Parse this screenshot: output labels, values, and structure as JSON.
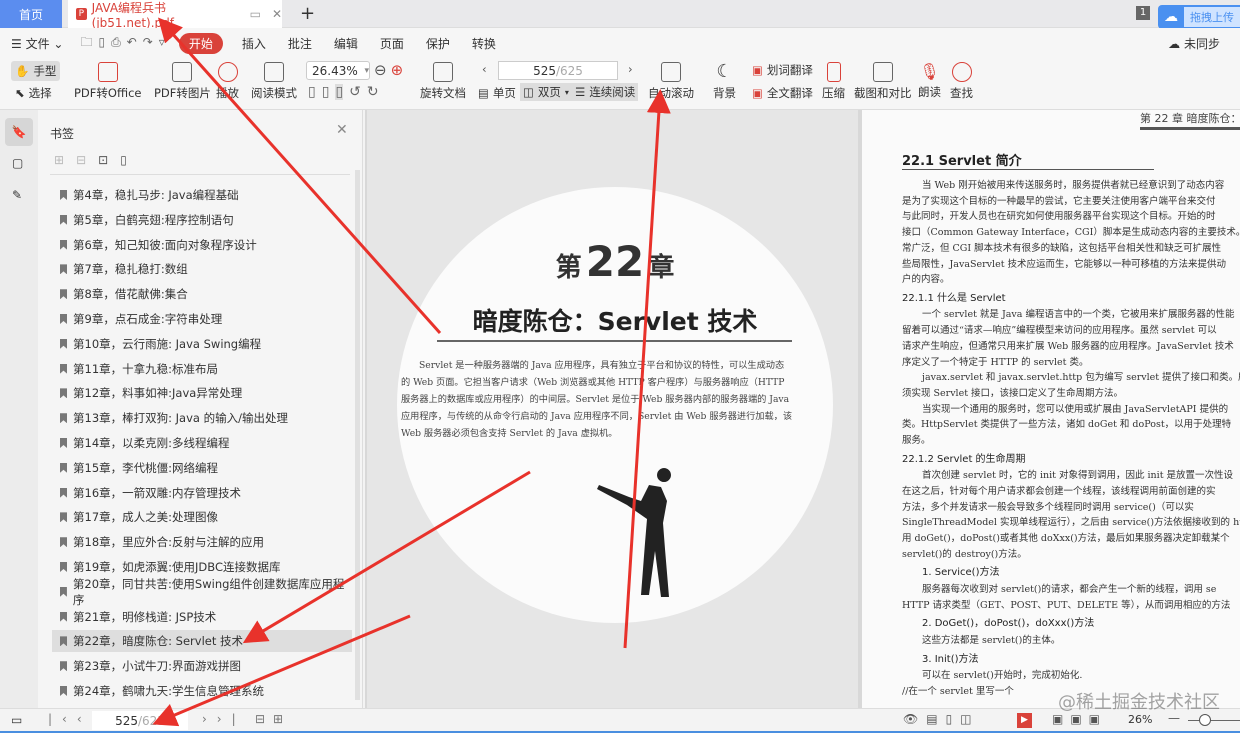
{
  "tabs": {
    "home": "首页",
    "doc": "JAVA编程兵书(jb51.net).pdf",
    "badge": "1",
    "upload": "拖拽上传"
  },
  "menu": {
    "file": "文件",
    "items": [
      "开始",
      "插入",
      "批注",
      "编辑",
      "页面",
      "保护",
      "转换"
    ],
    "sync": "未同步"
  },
  "ribbon": {
    "hand": "手型",
    "select": "选择",
    "pdf_office": "PDF转Office",
    "pdf_image": "PDF转图片",
    "play": "播放",
    "read_mode": "阅读模式",
    "zoom": "26.43%",
    "rotate": "旋转文档",
    "page": "525",
    "page_total": "/625",
    "single": "单页",
    "double": "双页",
    "continuous": "连续阅读",
    "autoscroll": "自动滚动",
    "background": "背景",
    "word_translate": "划词翻译",
    "full_translate": "全文翻译",
    "compress": "压缩",
    "screenshot": "截图和对比",
    "read_aloud": "朗读",
    "find": "查找"
  },
  "sidebar": {
    "title": "书签",
    "items": [
      "第4章，稳扎马步: Java编程基础",
      "第5章，白鹤亮翅:程序控制语句",
      "第6章，知己知彼:面向对象程序设计",
      "第7章，稳扎稳打:数组",
      "第8章，借花献佛:集合",
      "第9章，点石成金:字符串处理",
      "第10章，云行雨施: Java Swing编程",
      "第11章，十拿九稳:标准布局",
      "第12章，料事如神:Java异常处理",
      "第13章，棒打双狗: Java 的输入/输出处理",
      "第14章，以柔克刚:多线程编程",
      "第15章，李代桃僵:网络编程",
      "第16章，一箭双雕:内存管理技术",
      "第17章，成人之美:处理图像",
      "第18章，里应外合:反射与注解的应用",
      "第19章，如虎添翼:使用JDBC连接数据库",
      "第20章，同甘共苦:使用Swing组件创建数据库应用程序",
      "第21章，明修栈道: JSP技术",
      "第22章，暗度陈仓: Servlet 技术",
      "第23章，小试牛刀:界面游戏拼图",
      "第24章，鹤啸九天:学生信息管理系统"
    ],
    "selected_index": 18
  },
  "left_page": {
    "chapter_prefix": "第",
    "chapter_num": "22",
    "chapter_suffix": "章",
    "title": "暗度陈仓：Servlet 技术",
    "lines": [
      "Servlet 是一种服务器端的 Java 应用程序，具有独立于平台和协议的特性，可以生成动态",
      "的 Web 页面。它担当客户请求（Web 浏览器或其他 HTTP 客户程序）与服务器响应（HTTP",
      "服务器上的数据库或应用程序）的中间层。Servlet 是位于 Web 服务器内部的服务器端的 Java",
      "应用程序，与传统的从命令行启动的 Java 应用程序不同，Servlet 由 Web 服务器进行加载，该",
      "Web 服务器必须包含支持 Servlet 的 Java 虚拟机。"
    ]
  },
  "right_page": {
    "header": "第 22 章  暗度陈仓：",
    "section": "22.1  Servlet 简介",
    "lines": [
      {
        "t": "当 Web 刚开始被用来传送服务时，服务提供者就已经意识到了动态内容",
        "h": false,
        "i": true
      },
      {
        "t": "是为了实现这个目标的一种最早的尝试，它主要关注使用客户端平台来交付",
        "h": false
      },
      {
        "t": "与此同时，开发人员也在研究如何使用服务器平台实现这个目标。开始的时",
        "h": false
      },
      {
        "t": "接口（Common Gateway Interface，CGI）脚本是生成动态内容的主要技术。",
        "h": false
      },
      {
        "t": "常广泛，但 CGI 脚本技术有很多的缺陷，这包括平台相关性和缺乏可扩展性",
        "h": false
      },
      {
        "t": "些局限性，JavaServlet 技术应运而生，它能够以一种可移植的方法来提供动",
        "h": false
      },
      {
        "t": "户的内容。",
        "h": false
      },
      {
        "t": "22.1.1  什么是 Servlet",
        "h": true
      },
      {
        "t": "一个 servlet 就是 Java 编程语言中的一个类，它被用来扩展服务器的性能",
        "h": false,
        "i": true
      },
      {
        "t": "留着可以通过“请求—响应”编程模型来访问的应用程序。虽然 servlet 可以",
        "h": false
      },
      {
        "t": "请求产生响应，但通常只用来扩展 Web 服务器的应用程序。JavaServlet 技术",
        "h": false
      },
      {
        "t": "序定义了一个特定于 HTTP 的 servlet 类。",
        "h": false
      },
      {
        "t": "javax.servlet 和 javax.servlet.http 包为编写 servlet 提供了接口和类。所有",
        "h": false,
        "i": true
      },
      {
        "t": "须实现 Servlet 接口，该接口定义了生命周期方法。",
        "h": false
      },
      {
        "t": "当实现一个通用的服务时，您可以使用或扩展由 JavaServletAPI 提供的",
        "h": false,
        "i": true
      },
      {
        "t": "类。HttpServlet 类提供了一些方法，诸如 doGet 和 doPost，以用于处理特",
        "h": false
      },
      {
        "t": "服务。",
        "h": false
      },
      {
        "t": "22.1.2  Servlet 的生命周期",
        "h": true
      },
      {
        "t": "首次创建 servlet 时，它的 init 对象得到调用，因此 init 是放置一次性设",
        "h": false,
        "i": true
      },
      {
        "t": "在这之后，针对每个用户请求都会创建一个线程，该线程调用前面创建的实",
        "h": false
      },
      {
        "t": "方法，多个并发请求一般会导致多个线程同时调用 service()（可以实",
        "h": false
      },
      {
        "t": "SingleThreadModel 实现单线程运行），之后由 service()方法依据接收到的 htt",
        "h": false
      },
      {
        "t": "用 doGet()，doPost()或者其他 doXxx()方法，最后如果服务器决定卸载某个",
        "h": false
      },
      {
        "t": "servlet()的 destroy()方法。",
        "h": false
      },
      {
        "t": "1. Service()方法",
        "h": true,
        "i": true
      },
      {
        "t": "服务器每次收到对 servlet()的请求，都会产生一个新的线程，调用 se",
        "h": false,
        "i": true
      },
      {
        "t": "HTTP 请求类型（GET、POST、PUT、DELETE 等），从而调用相应的方法",
        "h": false
      },
      {
        "t": "2. DoGet()，doPost()，doXxx()方法",
        "h": true,
        "i": true
      },
      {
        "t": "这些方法都是 servlet()的主体。",
        "h": false,
        "i": true
      },
      {
        "t": "3. Init()方法",
        "h": true,
        "i": true
      },
      {
        "t": "可以在 servlet()开始时，完成初始化.",
        "h": false,
        "i": true
      },
      {
        "t": "//在一个 servlet 里写一个",
        "h": false
      }
    ]
  },
  "status": {
    "page": "525",
    "page_total": "/625",
    "zoom": "26%",
    "watermark": "@稀土掘金技术社区"
  },
  "colors": {
    "accent": "#d9423a",
    "blue": "#5b8def",
    "arrow": "#e8322b"
  }
}
